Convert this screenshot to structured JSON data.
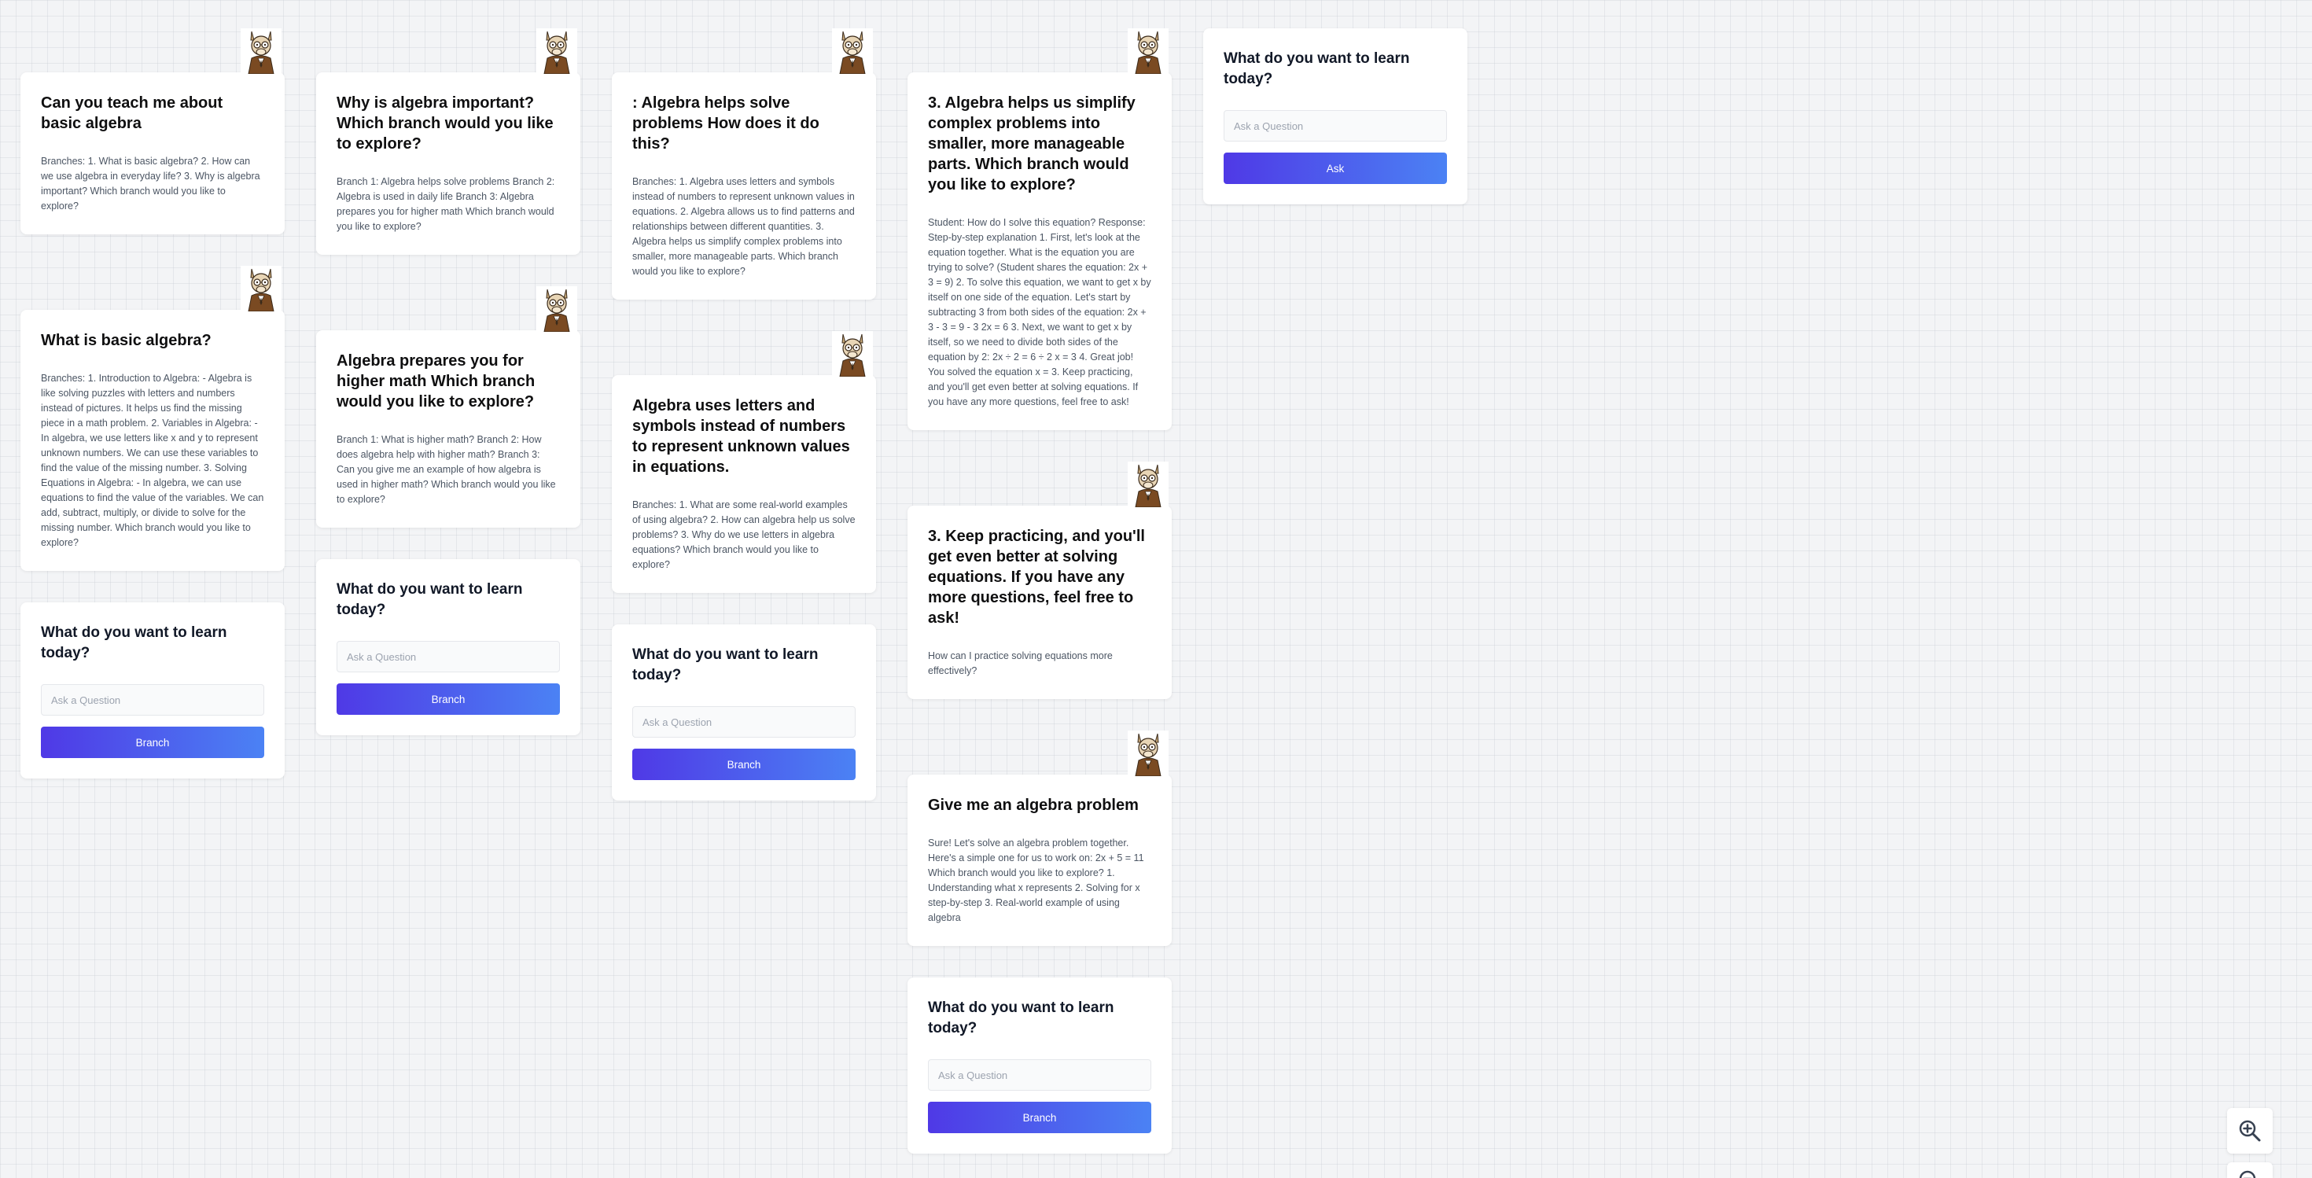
{
  "columns": [
    {
      "nodes": [
        {
          "title": "Can you teach me about basic algebra",
          "body": "Branches: 1. What is basic algebra? 2. How can we use algebra in everyday life? 3. Why is algebra important? Which branch would you like to explore?"
        },
        {
          "title": "What is basic algebra?",
          "body": "Branches: 1. Introduction to Algebra: - Algebra is like solving puzzles with letters and numbers instead of pictures. It helps us find the missing piece in a math problem. 2. Variables in Algebra: - In algebra, we use letters like x and y to represent unknown numbers. We can use these variables to find the value of the missing number. 3. Solving Equations in Algebra: - In algebra, we can use equations to find the value of the variables. We can add, subtract, multiply, or divide to solve for the missing number. Which branch would you like to explore?"
        }
      ],
      "ask": {
        "title": "What do you want to learn today?",
        "placeholder": "Ask a Question",
        "button": "Branch"
      }
    },
    {
      "nodes": [
        {
          "title": "Why is algebra important? Which branch would you like to explore?",
          "body": "Branch 1: Algebra helps solve problems Branch 2: Algebra is used in daily life Branch 3: Algebra prepares you for higher math Which branch would you like to explore?"
        },
        {
          "title": "Algebra prepares you for higher math Which branch would you like to explore?",
          "body": "Branch 1: What is higher math? Branch 2: How does algebra help with higher math? Branch 3: Can you give me an example of how algebra is used in higher math? Which branch would you like to explore?"
        }
      ],
      "ask": {
        "title": "What do you want to learn today?",
        "placeholder": "Ask a Question",
        "button": "Branch"
      }
    },
    {
      "nodes": [
        {
          "title": ": Algebra helps solve problems How does it do this?",
          "body": "Branches: 1. Algebra uses letters and symbols instead of numbers to represent unknown values in equations. 2. Algebra allows us to find patterns and relationships between different quantities. 3. Algebra helps us simplify complex problems into smaller, more manageable parts. Which branch would you like to explore?"
        },
        {
          "title": "Algebra uses letters and symbols instead of numbers to represent unknown values in equations.",
          "body": "Branches: 1. What are some real-world examples of using algebra? 2. How can algebra help us solve problems? 3. Why do we use letters in algebra equations? Which branch would you like to explore?"
        }
      ],
      "ask": {
        "title": "What do you want to learn today?",
        "placeholder": "Ask a Question",
        "button": "Branch"
      }
    },
    {
      "nodes": [
        {
          "title": "3. Algebra helps us simplify complex problems into smaller, more manageable parts. Which branch would you like to explore?",
          "body": "Student: How do I solve this equation? Response: Step-by-step explanation 1. First, let's look at the equation together. What is the equation you are trying to solve? (Student shares the equation: 2x + 3 = 9) 2. To solve this equation, we want to get x by itself on one side of the equation. Let's start by subtracting 3 from both sides of the equation: 2x + 3 - 3 = 9 - 3 2x = 6 3. Next, we want to get x by itself, so we need to divide both sides of the equation by 2: 2x ÷ 2 = 6 ÷ 2 x = 3 4. Great job! You solved the equation x = 3. Keep practicing, and you'll get even better at solving equations. If you have any more questions, feel free to ask!"
        },
        {
          "title": "3. Keep practicing, and you'll get even better at solving equations. If you have any more questions, feel free to ask!",
          "body": "How can I practice solving equations more effectively?"
        },
        {
          "title": "Give me an algebra problem",
          "body": "Sure! Let's solve an algebra problem together. Here's a simple one for us to work on: 2x + 5 = 11 Which branch would you like to explore? 1. Understanding what x represents 2. Solving for x step-by-step 3. Real-world example of using algebra"
        }
      ],
      "ask": {
        "title": "What do you want to learn today?",
        "placeholder": "Ask a Question",
        "button": "Branch"
      }
    },
    {
      "nodes": [],
      "ask": {
        "title": "What do you want to learn today?",
        "placeholder": "Ask a Question",
        "button": "Ask"
      }
    }
  ],
  "icons": {
    "avatar": "llama-teacher-avatar",
    "zoom_in": "zoom-in-icon",
    "zoom_out": "zoom-out-icon"
  },
  "colors": {
    "button_gradient_start": "#4f39e6",
    "button_gradient_end": "#4b82f4"
  }
}
